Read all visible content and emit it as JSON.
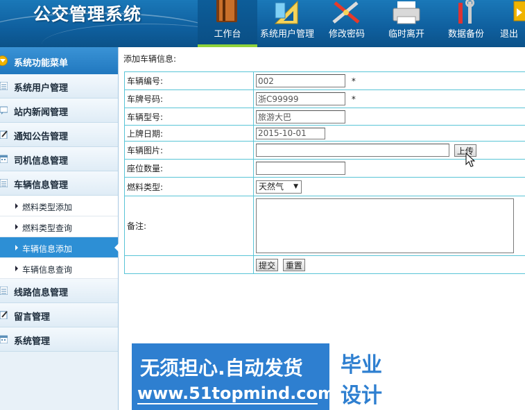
{
  "header": {
    "title": "公交管理系统",
    "nav": [
      {
        "label": "工作台",
        "icon": "book-icon",
        "active": true
      },
      {
        "label": "系统用户管理",
        "icon": "ruler-icon",
        "active": false
      },
      {
        "label": "修改密码",
        "icon": "tools-icon",
        "active": false
      },
      {
        "label": "临时离开",
        "icon": "printer-icon",
        "active": false
      },
      {
        "label": "数据备份",
        "icon": "wrench-icon",
        "active": false
      },
      {
        "label": "退出",
        "icon": "exit-icon",
        "active": false
      }
    ]
  },
  "sidebar": {
    "header": "系统功能菜单",
    "groups": [
      {
        "label": "系统用户管理",
        "icon": "list-icon"
      },
      {
        "label": "站内新闻管理",
        "icon": "chat-icon"
      },
      {
        "label": "通知公告管理",
        "icon": "edit-icon"
      },
      {
        "label": "司机信息管理",
        "icon": "calendar-icon"
      },
      {
        "label": "车辆信息管理",
        "icon": "list-icon"
      },
      {
        "label": "线路信息管理",
        "icon": "list-icon"
      },
      {
        "label": "留言管理",
        "icon": "edit-icon"
      },
      {
        "label": "系统管理",
        "icon": "calendar-icon"
      }
    ],
    "sub_items": [
      {
        "label": "燃料类型添加",
        "active": false
      },
      {
        "label": "燃料类型查询",
        "active": false
      },
      {
        "label": "车辆信息添加",
        "active": true
      },
      {
        "label": "车辆信息查询",
        "active": false
      }
    ]
  },
  "form": {
    "page_title": "添加车辆信息:",
    "vehicle_no": {
      "label": "车辆编号:",
      "value": "002",
      "required": "*"
    },
    "plate_no": {
      "label": "车牌号码:",
      "value": "浙C99999",
      "required": "*"
    },
    "model": {
      "label": "车辆型号:",
      "value": "旅游大巴"
    },
    "plate_date": {
      "label": "上牌日期:",
      "value": "2015-10-01"
    },
    "photo": {
      "label": "车辆图片:",
      "value": "",
      "upload_label": "上传"
    },
    "seats": {
      "label": "座位数量:",
      "value": ""
    },
    "fuel": {
      "label": "燃料类型:",
      "value": "天然气"
    },
    "notes": {
      "label": "备注:",
      "value": ""
    },
    "submit_label": "提交",
    "reset_label": "重置"
  },
  "ad": {
    "slogan": "无须担心.自动发货",
    "url": "www.51topmind.com",
    "right_top": "毕业",
    "right_bottom": "设计"
  },
  "colors": {
    "header_blue": "#0f5f9e",
    "active_menu": "#2d8fd5",
    "table_border": "#58c4d6",
    "active_tab_underline": "#8fd23a"
  }
}
